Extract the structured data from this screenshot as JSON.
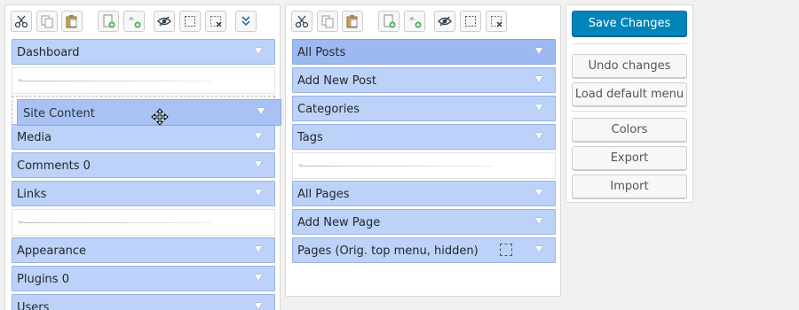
{
  "left_column": {
    "items": [
      {
        "label": "Dashboard"
      },
      {
        "label": "Media"
      },
      {
        "label": "Comments 0"
      },
      {
        "label": "Links"
      },
      {
        "label": "Appearance"
      },
      {
        "label": "Plugins 0"
      },
      {
        "label": "Users"
      }
    ],
    "dragging_item": {
      "label": "Site Content"
    }
  },
  "right_column": {
    "items": [
      {
        "label": "All Posts"
      },
      {
        "label": "Add New Post"
      },
      {
        "label": "Categories"
      },
      {
        "label": "Tags"
      },
      {
        "label": "All Pages"
      },
      {
        "label": "Add New Page"
      },
      {
        "label": "Pages (Orig. top menu, hidden)"
      }
    ]
  },
  "actions": {
    "save": "Save Changes",
    "undo": "Undo changes",
    "load_default": "Load default menu",
    "colors": "Colors",
    "export": "Export",
    "import": "Import"
  },
  "toolbar_icons": [
    "cut-icon",
    "copy-icon",
    "paste-icon",
    "new-menu-icon",
    "new-separator-icon",
    "toggle-hidden-icon",
    "hide-icon",
    "delete-icon",
    "expand-all-icon"
  ],
  "colors": {
    "item_bg": "#bcd2f8",
    "item_selected_bg": "#9cb9f2",
    "primary_button": "#0085ba"
  }
}
